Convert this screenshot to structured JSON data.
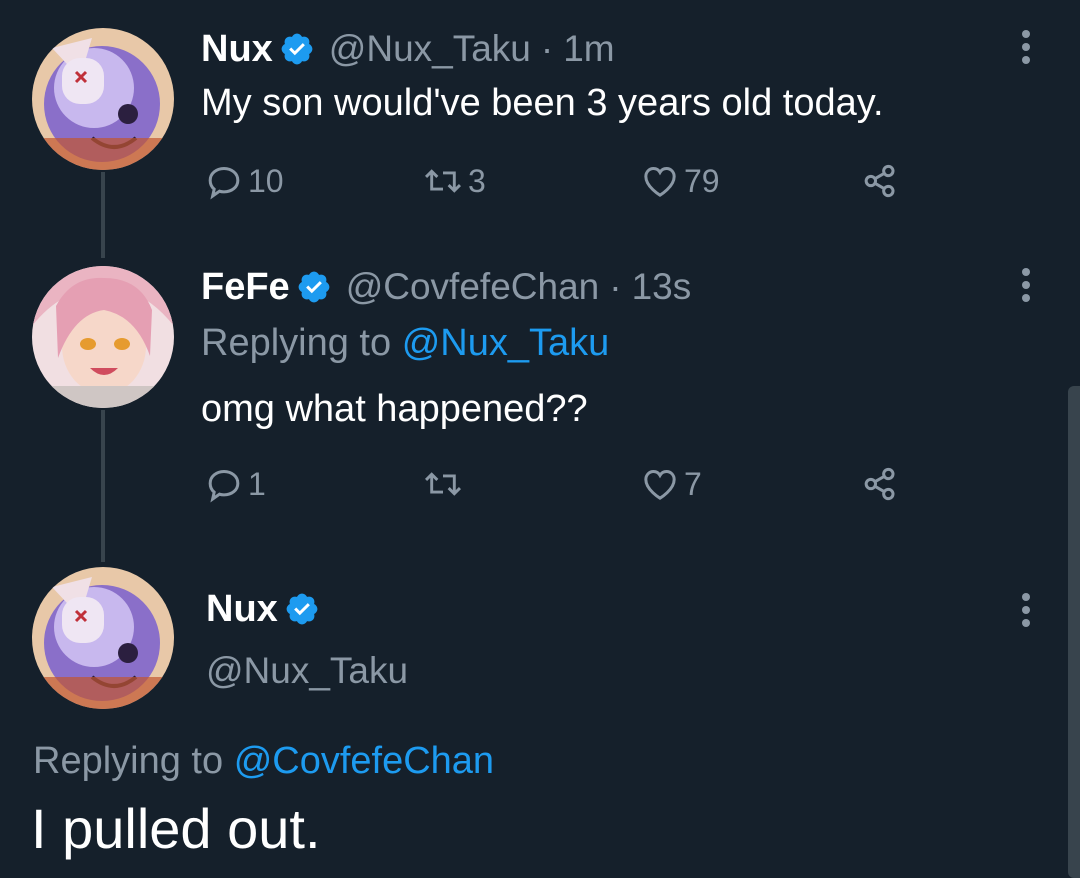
{
  "tweets": [
    {
      "name": "Nux",
      "handle": "@Nux_Taku",
      "separator": "·",
      "time": "1m",
      "text": "My son would've been 3 years old today.",
      "replies": "10",
      "retweets": "3",
      "likes": "79"
    },
    {
      "name": "FeFe",
      "handle": "@CovfefeChan",
      "separator": "·",
      "time": "13s",
      "replying_prefix": "Replying to",
      "replying_to": "@Nux_Taku",
      "text": "omg what happened??",
      "replies": "1",
      "retweets": "",
      "likes": "7"
    }
  ],
  "focused": {
    "name": "Nux",
    "handle": "@Nux_Taku",
    "replying_prefix": "Replying to",
    "replying_to": "@CovfefeChan",
    "text": "I pulled out."
  },
  "icons": {
    "reply": "reply-icon",
    "retweet": "retweet-icon",
    "like": "heart-icon",
    "share": "share-icon",
    "more": "more-vertical-icon",
    "verified": "verified-badge-icon"
  },
  "colors": {
    "background": "#15202b",
    "text": "#ffffff",
    "muted": "#8b98a5",
    "accent": "#1d9bf0",
    "line": "#38444d"
  }
}
